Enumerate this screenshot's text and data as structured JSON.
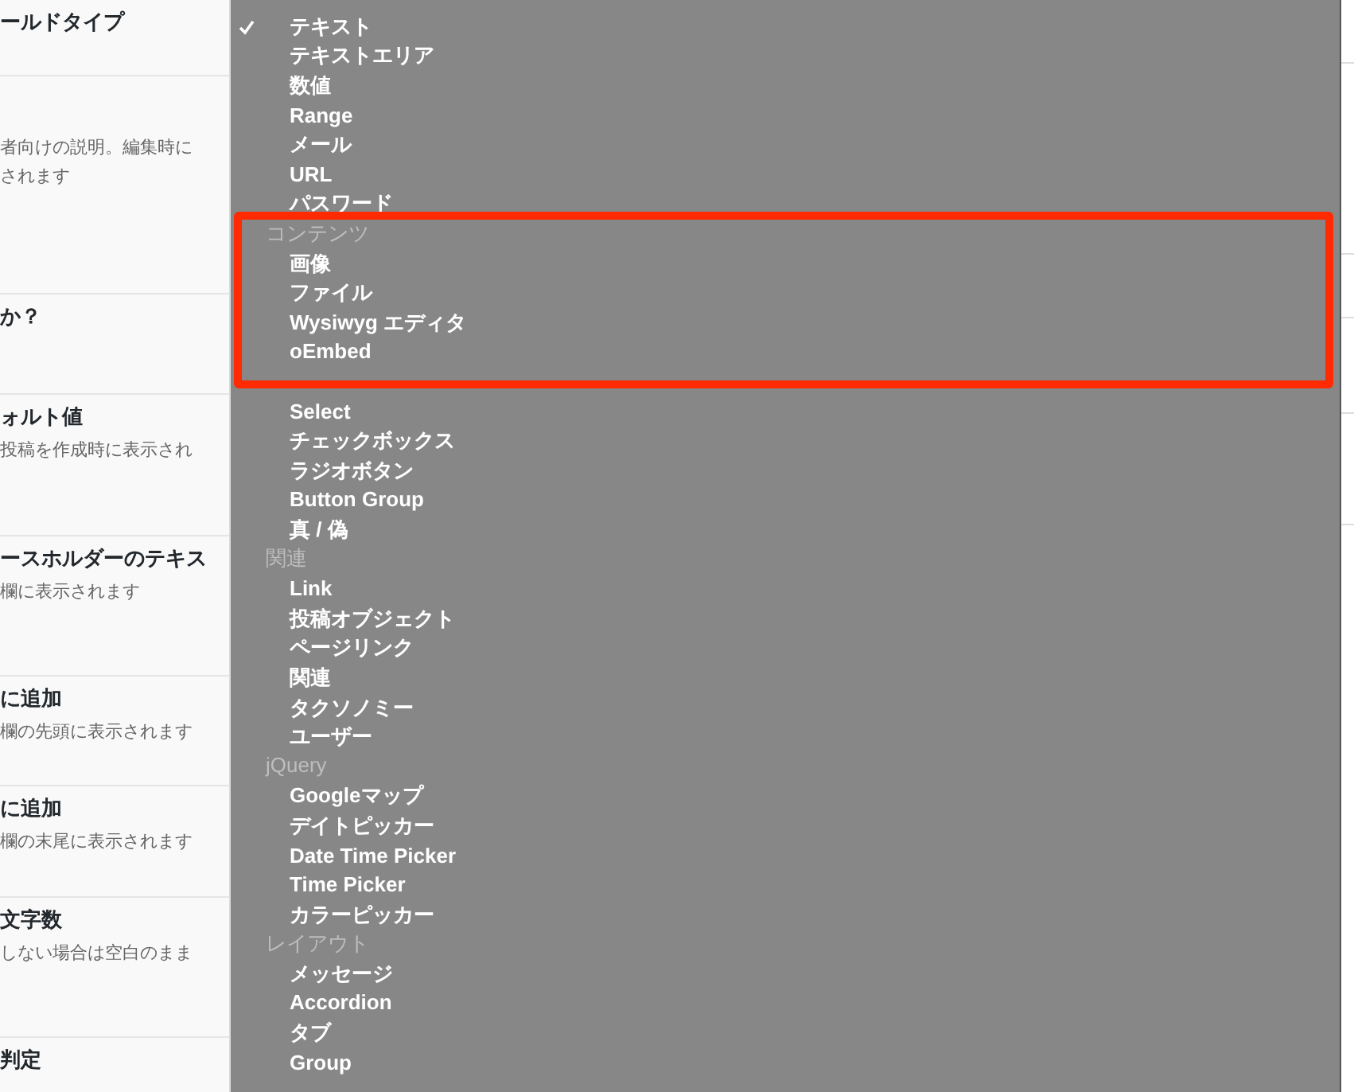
{
  "settings_rows": [
    {
      "label": "ールドタイプ"
    },
    {
      "description": "者向けの説明。編集時にされます"
    },
    {
      "label": "か？"
    },
    {
      "label": "ォルト値",
      "description": "投稿を作成時に表示され"
    },
    {
      "label": "ースホルダーのテキス",
      "description": "欄に表示されます"
    },
    {
      "label": "に追加",
      "description": "欄の先頭に表示されます"
    },
    {
      "label": "に追加",
      "description": "欄の末尾に表示されます"
    },
    {
      "label": "文字数",
      "description": "しない場合は空白のまま"
    },
    {
      "label": "判定"
    }
  ],
  "dropdown_menu": {
    "groups": [
      {
        "items": [
          {
            "label": "テキスト",
            "selected": true
          },
          {
            "label": "テキストエリア",
            "selected": false
          },
          {
            "label": "数値",
            "selected": false
          },
          {
            "label": "Range",
            "selected": false
          },
          {
            "label": "メール",
            "selected": false
          },
          {
            "label": "URL",
            "selected": false
          },
          {
            "label": "パスワード",
            "selected": false
          }
        ]
      },
      {
        "label": "コンテンツ",
        "items": [
          {
            "label": "画像",
            "selected": false
          },
          {
            "label": "ファイル",
            "selected": false
          },
          {
            "label": "Wysiwyg エディタ",
            "selected": false
          },
          {
            "label": "oEmbed",
            "selected": false
          }
        ]
      },
      {
        "items": [
          {
            "label": "Select",
            "selected": false
          },
          {
            "label": "チェックボックス",
            "selected": false
          },
          {
            "label": "ラジオボタン",
            "selected": false
          },
          {
            "label": "Button Group",
            "selected": false
          },
          {
            "label": "真 / 偽",
            "selected": false
          }
        ]
      },
      {
        "label": "関連",
        "items": [
          {
            "label": "Link",
            "selected": false
          },
          {
            "label": "投稿オブジェクト",
            "selected": false
          },
          {
            "label": "ページリンク",
            "selected": false
          },
          {
            "label": "関連",
            "selected": false
          },
          {
            "label": "タクソノミー",
            "selected": false
          },
          {
            "label": "ユーザー",
            "selected": false
          }
        ]
      },
      {
        "label": "jQuery",
        "items": [
          {
            "label": "Googleマップ",
            "selected": false
          },
          {
            "label": "デイトピッカー",
            "selected": false
          },
          {
            "label": "Date Time Picker",
            "selected": false
          },
          {
            "label": "Time Picker",
            "selected": false
          },
          {
            "label": "カラーピッカー",
            "selected": false
          }
        ]
      },
      {
        "label": "レイアウト",
        "items": [
          {
            "label": "メッセージ",
            "selected": false
          },
          {
            "label": "Accordion",
            "selected": false
          },
          {
            "label": "タブ",
            "selected": false
          },
          {
            "label": "Group",
            "selected": false
          }
        ]
      }
    ]
  }
}
